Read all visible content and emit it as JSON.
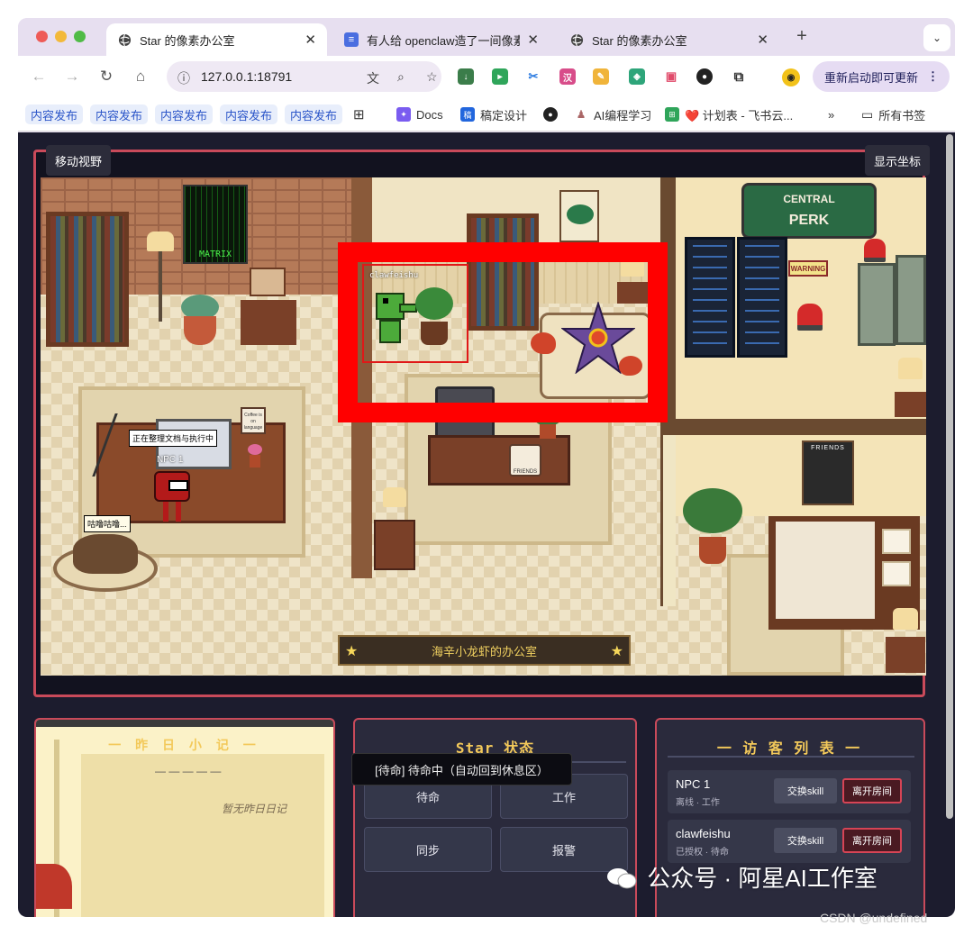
{
  "browser": {
    "tabs": [
      {
        "label": "Star 的像素办公室",
        "icon": "globe-icon",
        "active": true
      },
      {
        "label": "有人给 openclaw造了一间像素",
        "icon": "docs-icon",
        "active": false
      },
      {
        "label": "Star 的像素办公室",
        "icon": "globe-icon",
        "active": false
      }
    ],
    "address": "127.0.0.1:18791",
    "update_label": "重新启动即可更新",
    "bookmarks": [
      "内容发布",
      "内容发布",
      "内容发布",
      "内容发布",
      "内容发布",
      "Docs",
      "稿定设计",
      "AI编程学习",
      "❤️ 计划表 - 飞书云...",
      "所有书签"
    ],
    "overflow_label": "»"
  },
  "game": {
    "move_view_label": "移动视野",
    "show_coords_label": "显示坐标",
    "room_label": "海辛小龙虾的办公室",
    "matrix_poster": "MATRIX",
    "sign_top": "CENTRAL",
    "sign_bottom": "PERK",
    "warning_sign": "WARNING",
    "friends_poster": "FRIENDS",
    "mug_text": "FRIENDS",
    "mug_text_small": "Coffee is on language",
    "npc_bubble": "正在整理文档与执行中",
    "npc_name": "NPC 1",
    "cat_bubble": "咕噜咕噜...",
    "agent_name": "clawfeishu"
  },
  "diary": {
    "title": "一 昨 日 小 记 一",
    "dash_line": "— — — — —",
    "empty_text": "暂无昨日日记"
  },
  "status": {
    "title": "Star 状态",
    "buttons": [
      "待命",
      "工作",
      "同步",
      "报警"
    ]
  },
  "visitors": {
    "title": "一 访 客 列 表 一",
    "items": [
      {
        "name": "NPC 1",
        "sub": "离线 · 工作",
        "skill": "交换skill",
        "leave": "离开房间"
      },
      {
        "name": "clawfeishu",
        "sub": "已授权 · 待命",
        "skill": "交换skill",
        "leave": "离开房间"
      }
    ]
  },
  "toast": "[待命] 待命中（自动回到休息区）",
  "watermark": "公众号 · 阿星AI工作室",
  "csdn": "CSDN @undefined",
  "colors": {
    "accent": "#c94a5a",
    "gold": "#f3c95a",
    "highlight": "#ff0000"
  }
}
